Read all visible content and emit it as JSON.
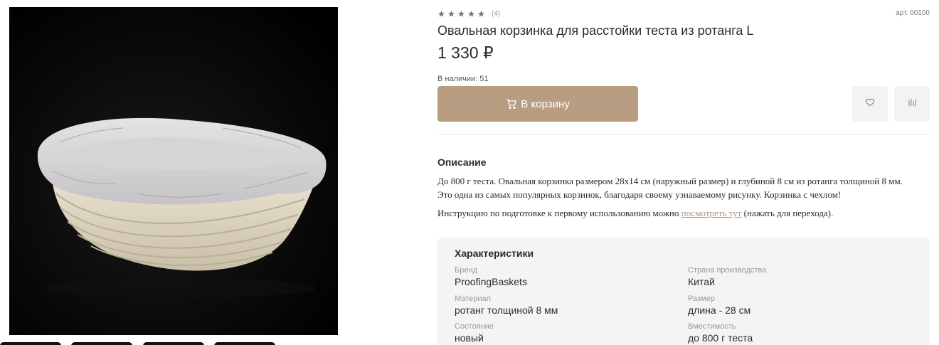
{
  "product": {
    "rating_count": "(4)",
    "sku": "арт. 00100",
    "title": "Овальная корзинка для расстойки теста из ротанга L",
    "price": "1 330 ₽",
    "stock": "В наличии: 51",
    "cart_label": "В корзину"
  },
  "description": {
    "heading": "Описание",
    "lines": [
      "До 800 г теста. Овальная корзинка размером 28x14 см (наружный размер) и глубиной 8 см из ротанга толщиной 8 мм.",
      "Это одна из самых популярных корзинок, благодаря своему узнаваемому рисунку. Корзинка с чехлом!"
    ],
    "instruction_before": "Инструкцию по подготовке к первому использованию можно ",
    "instruction_link": "посмотреть тут",
    "instruction_after": " (нажать для перехода)."
  },
  "specs": {
    "heading": "Характеристики",
    "items": [
      {
        "label": "Бренд",
        "value": "ProofingBaskets"
      },
      {
        "label": "Страна производства",
        "value": "Китай"
      },
      {
        "label": "Материал",
        "value": "ротанг толщиной 8 мм"
      },
      {
        "label": "Размер",
        "value": "длина - 28 см"
      },
      {
        "label": "Состояние",
        "value": "новый"
      },
      {
        "label": "Вместимость",
        "value": "до 800 г теста"
      }
    ]
  },
  "icons": {
    "star": "star-icon",
    "cart": "cart-icon",
    "favorite": "heart-icon",
    "compare": "bar-chart-icon"
  },
  "colors": {
    "accent": "#b99d82",
    "link": "#b29478",
    "star": "#7a7a7a"
  }
}
